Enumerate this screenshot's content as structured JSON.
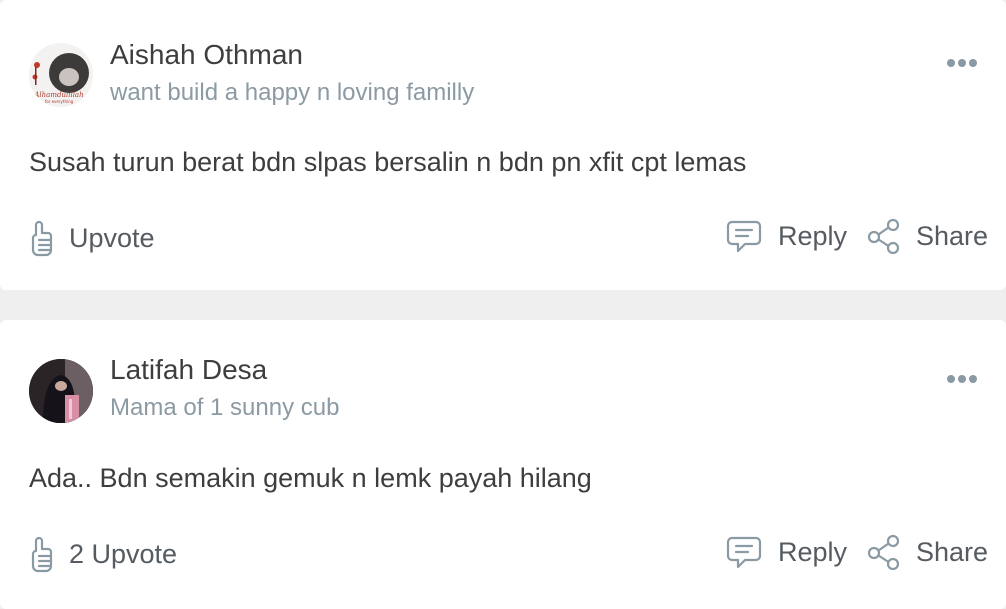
{
  "comments": [
    {
      "author": "Aishah Othman",
      "bio": "want build a happy n loving familly",
      "avatar_text": "Alhamdulillah for everything",
      "text": "Susah turun berat bdn slpas bersalin n bdn pn xfit cpt lemas",
      "upvote_label": "Upvote",
      "reply_label": "Reply",
      "share_label": "Share"
    },
    {
      "author": "Latifah Desa",
      "bio": "Mama of 1 sunny cub",
      "text": "Ada.. Bdn semakin gemuk n lemk payah hilang",
      "upvote_label": "2 Upvote",
      "reply_label": "Reply",
      "share_label": "Share"
    }
  ],
  "icons": {
    "upvote": "thumbs-up-icon",
    "reply": "chat-bubble-icon",
    "share": "share-icon",
    "more": "more-dots-icon"
  },
  "colors": {
    "background": "#efefef",
    "card": "#ffffff",
    "text": "#3e3e3e",
    "muted": "#8b9aa3",
    "icon": "#8a9aa4"
  }
}
